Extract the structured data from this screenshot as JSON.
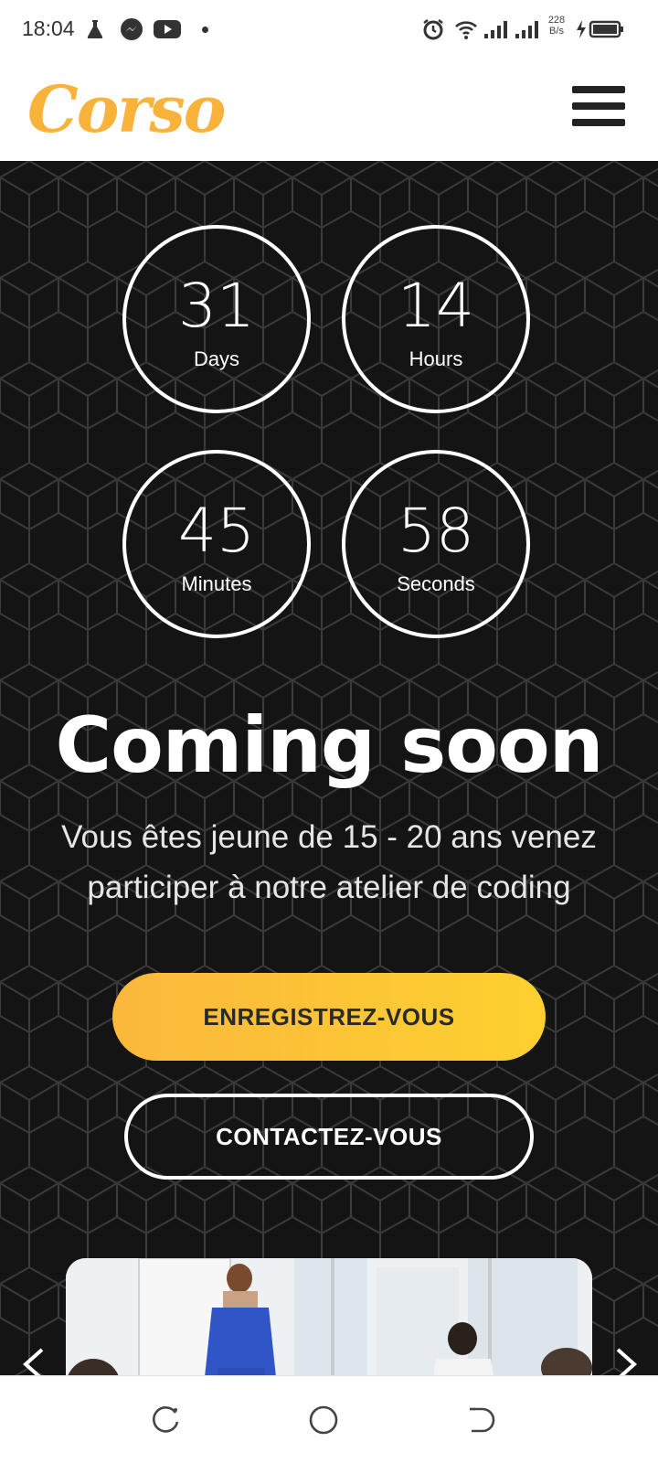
{
  "status_bar": {
    "time": "18:04",
    "left_icons": [
      "flask-icon",
      "messenger-icon",
      "youtube-icon",
      "notification-dot-icon"
    ],
    "right_icons": [
      "alarm-icon",
      "wifi-icon",
      "signal-icon",
      "signal-icon",
      "battery-charging-icon"
    ],
    "net_speed_value": "228",
    "net_speed_unit": "B/s"
  },
  "header": {
    "logo_text": "Corso",
    "logo_color": "#f9b33b",
    "menu_icon": "hamburger-menu-icon"
  },
  "countdown": [
    {
      "value": "31",
      "label": "Days"
    },
    {
      "value": "14",
      "label": "Hours"
    },
    {
      "value": "45",
      "label": "Minutes"
    },
    {
      "value": "58",
      "label": "Seconds"
    }
  ],
  "hero": {
    "title": "Coming soon",
    "text_line1": "Vous êtes jeune de 15 - 20 ans venez",
    "text_line2": "participer à notre atelier de coding",
    "register_label": "ENREGISTREZ-VOUS",
    "contact_label": "CONTACTEZ-VOUS",
    "accent_color": "#fdc331",
    "background_color": "#141414"
  },
  "carousel": {
    "prev_icon": "chevron-left-icon",
    "next_icon": "chevron-right-icon"
  },
  "nav_bar": {
    "icons": [
      "recent-apps-icon",
      "home-icon",
      "back-icon"
    ]
  }
}
